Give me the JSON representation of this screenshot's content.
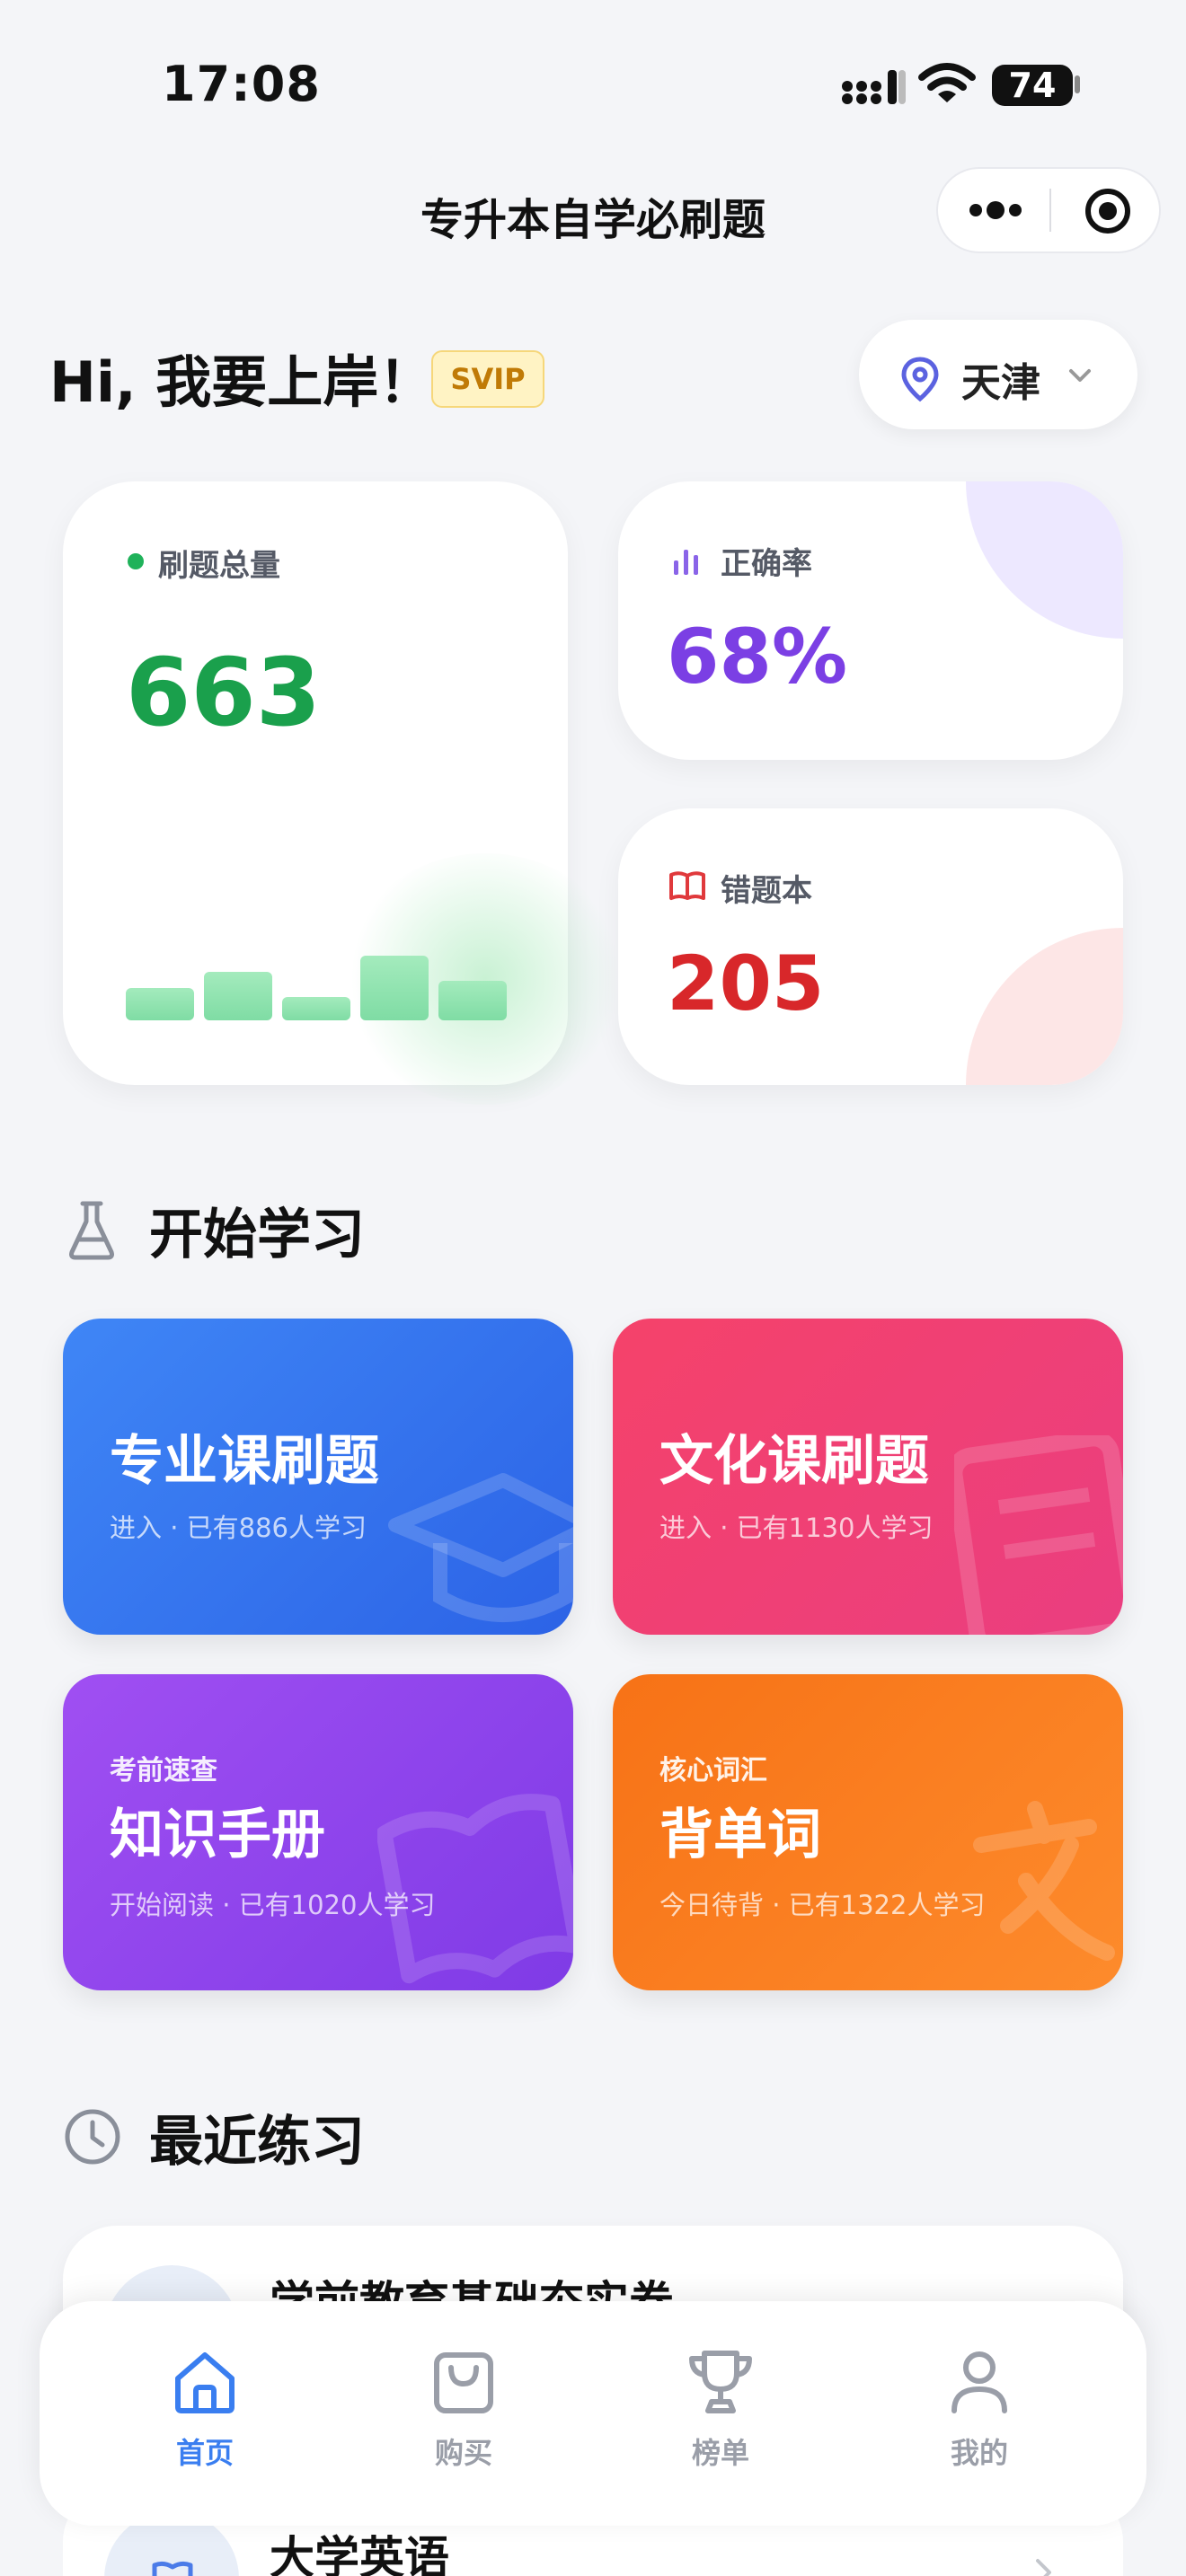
{
  "status_bar": {
    "time": "17:08",
    "battery": "74"
  },
  "app": {
    "title": "专升本自学必刷题"
  },
  "header": {
    "greeting": "Hi, 我要上岸！",
    "badge": "SVIP",
    "location": "天津"
  },
  "stats": {
    "total": {
      "label": "刷题总量",
      "value": "663",
      "bars": [
        0.45,
        0.68,
        0.33,
        0.9,
        0.55
      ]
    },
    "accuracy": {
      "label": "正确率",
      "value": "68%"
    },
    "wrong_book": {
      "label": "错题本",
      "value": "205"
    }
  },
  "study": {
    "section_title": "开始学习",
    "tiles": [
      {
        "title": "专业课刷题",
        "subtitle": "进入 · 已有886人学习"
      },
      {
        "title": "文化课刷题",
        "subtitle": "进入 · 已有1130人学习"
      },
      {
        "kicker": "考前速查",
        "title": "知识手册",
        "subtitle": "开始阅读 · 已有1020人学习"
      },
      {
        "kicker": "核心词汇",
        "title": "背单词",
        "subtitle": "今日待背 · 已有1322人学习"
      }
    ]
  },
  "recent": {
    "section_title": "最近练习",
    "items": [
      {
        "name": "学前教育基础夯实卷"
      },
      {
        "name": "大学英语"
      }
    ]
  },
  "tabbar": {
    "items": [
      {
        "label": "首页",
        "icon": "home-icon",
        "active": true
      },
      {
        "label": "购买",
        "icon": "bag-icon",
        "active": false
      },
      {
        "label": "榜单",
        "icon": "trophy-icon",
        "active": false
      },
      {
        "label": "我的",
        "icon": "user-icon",
        "active": false
      }
    ]
  },
  "colors": {
    "accent_blue": "#3a7ef0",
    "total_green": "#1aa04c",
    "accuracy_purple": "#7b3fe4",
    "wrong_red": "#d8272a"
  }
}
